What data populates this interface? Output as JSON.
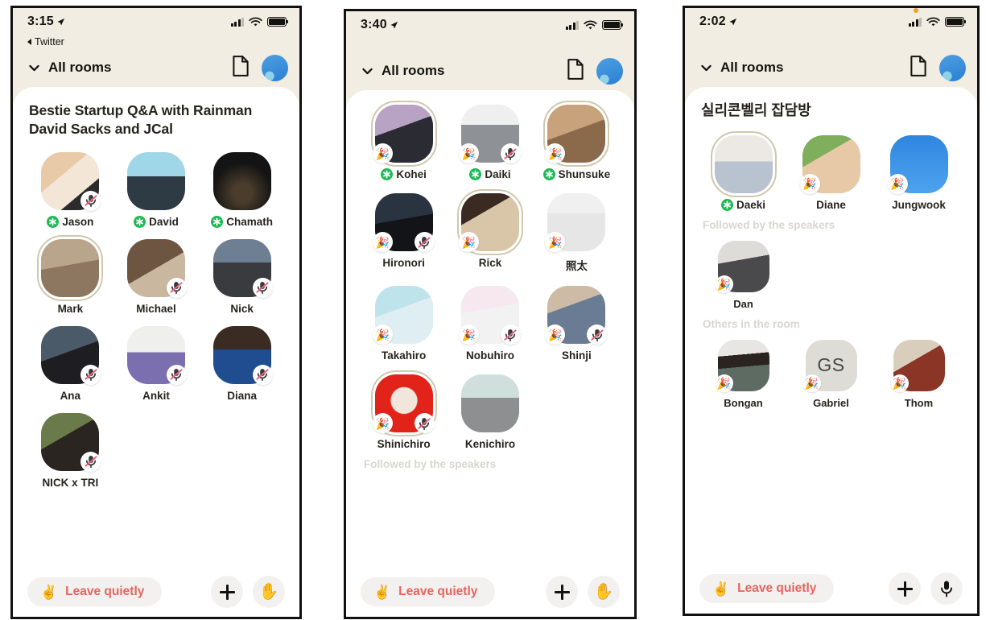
{
  "app": {
    "nav_label": "All rooms",
    "leave_label": "Leave quietly",
    "leave_emoji": "✌️",
    "party_emoji": "🎉",
    "hand_emoji": "✋",
    "section_followed": "Followed by the speakers",
    "section_others": "Others in the room",
    "colors": {
      "header_bg": "#f1ede3",
      "card_bg": "#ffffff",
      "leave_text": "#e8635e",
      "leave_pill": "#f2f1ef",
      "speaker_green": "#1db954",
      "section_label": "#d8d6d1",
      "ring": "#cfc8ae",
      "mute_slash": "#e8617f"
    },
    "icons": {
      "chevron": "chevron-down-icon",
      "doc": "document-icon",
      "avatar": "profile-avatar-icon",
      "plus": "plus-icon",
      "hand": "raise-hand-icon",
      "mic": "microphone-icon",
      "mute": "mic-muted-icon",
      "speaker": "speaker-asterisk-icon"
    }
  },
  "phones": [
    {
      "id": "phone-1",
      "status": {
        "time": "3:15",
        "back_app": "Twitter",
        "show_back": true,
        "recording_dot": false
      },
      "room_title": "Bestie Startup Q&A with Rainman David Sacks and JCal",
      "bottom_action": "hand",
      "sections": [
        {
          "label": null,
          "members": [
            {
              "name": "Jason",
              "speaker": true,
              "muted": true,
              "party": false,
              "ring": false,
              "img": "jason"
            },
            {
              "name": "David",
              "speaker": true,
              "muted": false,
              "party": false,
              "ring": false,
              "img": "david"
            },
            {
              "name": "Chamath",
              "speaker": true,
              "muted": false,
              "party": false,
              "ring": false,
              "img": "chamath"
            },
            {
              "name": "Mark",
              "speaker": false,
              "muted": false,
              "party": false,
              "ring": true,
              "img": "mark"
            },
            {
              "name": "Michael",
              "speaker": false,
              "muted": true,
              "party": false,
              "ring": false,
              "img": "michael"
            },
            {
              "name": "Nick",
              "speaker": false,
              "muted": true,
              "party": false,
              "ring": false,
              "img": "nick"
            },
            {
              "name": "Ana",
              "speaker": false,
              "muted": true,
              "party": false,
              "ring": false,
              "img": "ana"
            },
            {
              "name": "Ankit",
              "speaker": false,
              "muted": true,
              "party": false,
              "ring": false,
              "img": "ankit"
            },
            {
              "name": "Diana",
              "speaker": false,
              "muted": true,
              "party": false,
              "ring": false,
              "img": "diana"
            },
            {
              "name": "NICK x TRI",
              "speaker": false,
              "muted": true,
              "party": false,
              "ring": false,
              "img": "nicktri"
            }
          ]
        }
      ]
    },
    {
      "id": "phone-2",
      "status": {
        "time": "3:40",
        "back_app": null,
        "show_back": false,
        "recording_dot": false
      },
      "room_title": null,
      "bottom_action": "hand",
      "footer_label": "Followed by the speakers",
      "sections": [
        {
          "label": null,
          "members": [
            {
              "name": "Kohei",
              "speaker": true,
              "muted": false,
              "party": true,
              "ring": true,
              "img": "kohei"
            },
            {
              "name": "Daiki",
              "speaker": true,
              "muted": true,
              "party": true,
              "ring": false,
              "img": "daiki"
            },
            {
              "name": "Shunsuke",
              "speaker": true,
              "muted": false,
              "party": true,
              "ring": true,
              "img": "shunsuke"
            },
            {
              "name": "Hironori",
              "speaker": false,
              "muted": true,
              "party": true,
              "ring": false,
              "img": "hironori"
            },
            {
              "name": "Rick",
              "speaker": false,
              "muted": false,
              "party": true,
              "ring": true,
              "img": "rick"
            },
            {
              "name": "照太",
              "speaker": false,
              "muted": false,
              "party": true,
              "ring": false,
              "img": "shota"
            },
            {
              "name": "Takahiro",
              "speaker": false,
              "muted": false,
              "party": true,
              "ring": false,
              "img": "takahiro"
            },
            {
              "name": "Nobuhiro",
              "speaker": false,
              "muted": true,
              "party": true,
              "ring": false,
              "img": "nobuhiro"
            },
            {
              "name": "Shinji",
              "speaker": false,
              "muted": true,
              "party": true,
              "ring": false,
              "img": "shinji"
            },
            {
              "name": "Shinichiro",
              "speaker": false,
              "muted": true,
              "party": true,
              "ring": true,
              "img": "shinichiro"
            },
            {
              "name": "Kenichiro",
              "speaker": false,
              "muted": false,
              "party": false,
              "ring": false,
              "img": "kenichiro"
            }
          ]
        }
      ]
    },
    {
      "id": "phone-3",
      "status": {
        "time": "2:02",
        "back_app": null,
        "show_back": false,
        "recording_dot": true
      },
      "room_title": "실리콘벨리 잡담방",
      "bottom_action": "mic",
      "sections": [
        {
          "label": null,
          "members": [
            {
              "name": "Daeki",
              "speaker": true,
              "muted": false,
              "party": false,
              "ring": true,
              "img": "daeki"
            },
            {
              "name": "Diane",
              "speaker": false,
              "muted": false,
              "party": true,
              "ring": false,
              "img": "diane"
            },
            {
              "name": "Jungwook",
              "speaker": false,
              "muted": false,
              "party": true,
              "ring": false,
              "img": "jungwook"
            }
          ]
        },
        {
          "label": "Followed by the speakers",
          "members": [
            {
              "name": "Dan",
              "speaker": false,
              "muted": false,
              "party": true,
              "ring": false,
              "img": "dan",
              "small": true
            }
          ]
        },
        {
          "label": "Others in the room",
          "members": [
            {
              "name": "Bongan",
              "speaker": false,
              "muted": false,
              "party": true,
              "ring": false,
              "img": "bongan",
              "small": true
            },
            {
              "name": "Gabriel",
              "speaker": false,
              "muted": false,
              "party": true,
              "ring": false,
              "initials": "GS",
              "small": true
            },
            {
              "name": "Thom",
              "speaker": false,
              "muted": false,
              "party": true,
              "ring": false,
              "img": "thom",
              "small": true
            }
          ]
        }
      ]
    }
  ]
}
